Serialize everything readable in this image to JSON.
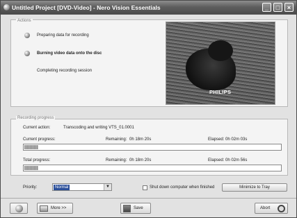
{
  "window": {
    "title": "Untitled Project [DVD-Video] - Nero Vision Essentials",
    "minimize_glyph": "_",
    "maximize_glyph": "□",
    "close_glyph": "×"
  },
  "actions": {
    "legend": "Actions",
    "steps": [
      {
        "label": "Preparing data for recording",
        "state": "done",
        "icon": "step-done-icon"
      },
      {
        "label": "Burning video data onto the disc",
        "state": "active",
        "icon": "step-active-icon"
      },
      {
        "label": "Completing recording session",
        "state": "pending",
        "icon": ""
      }
    ]
  },
  "preview": {
    "brand_text": "PHILIPS"
  },
  "recording_progress": {
    "legend": "Recording progress",
    "current_action_label": "Current action:",
    "current_action_value": "Transcoding and writing VTS_01.0001",
    "current_progress_label": "Current progress:",
    "current_remaining_label": "Remaining:",
    "current_remaining_value": "0h 18m 20s",
    "current_elapsed_label": "Elapsed:",
    "current_elapsed_value": "0h 02m 03s",
    "current_progress_fraction": 0.06,
    "total_progress_label": "Total progress:",
    "total_remaining_label": "Remaining:",
    "total_remaining_value": "0h 18m 20s",
    "total_elapsed_label": "Elapsed:",
    "total_elapsed_value": "0h 02m 56s",
    "total_progress_fraction": 0.06
  },
  "options": {
    "priority_label": "Priority:",
    "priority_value": "Normal",
    "shutdown_label": "Shut down computer when finished",
    "shutdown_checked": false,
    "minimize_label": "Minimize to Tray"
  },
  "footer": {
    "more_label": "More >>",
    "save_label": "Save",
    "abort_label": "Abort"
  }
}
